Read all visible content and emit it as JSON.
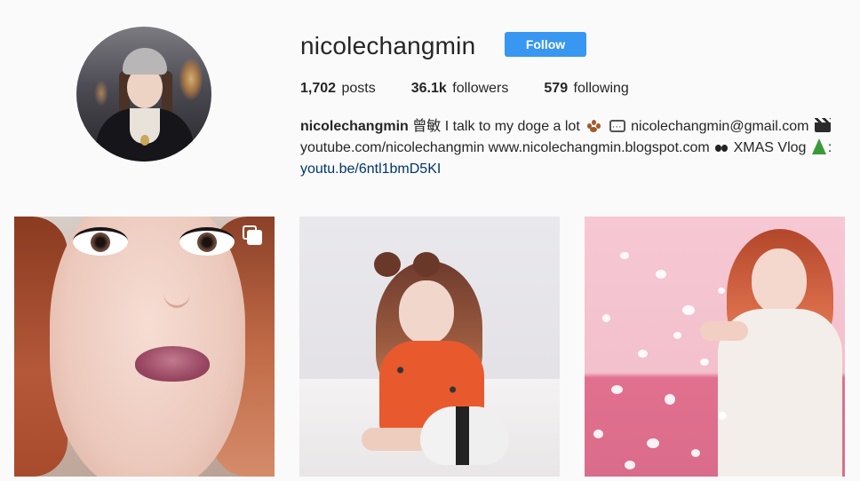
{
  "profile": {
    "username": "nicolechangmin",
    "follow_label": "Follow",
    "stats": {
      "posts_count": "1,702",
      "posts_label": "posts",
      "followers_count": "36.1k",
      "followers_label": "followers",
      "following_count": "579",
      "following_label": "following"
    },
    "bio": {
      "full_name": "nicolechangmin",
      "line1_text": "曾敏 I talk to my doge a lot",
      "email": "nicolechangmin@gmail.com",
      "line2_text": "youtube.com/nicolechangmin www.nicolechangmin.blogspot.com",
      "vlog_text": "XMAS Vlog",
      "colon": ":",
      "link": "youtu.be/6ntl1bmD5KI"
    }
  },
  "colors": {
    "follow_button": "#3897f0",
    "link": "#003569",
    "background": "#fafafa"
  },
  "icons": {
    "multi_post": "multiple-images-icon",
    "paw": "paw-prints-emoji",
    "speech": "speech-bubble-emoji",
    "clapper": "clapper-board-emoji",
    "bow": "bow-emoji",
    "tree": "christmas-tree-emoji"
  },
  "posts": [
    {
      "type": "carousel"
    },
    {
      "type": "photo"
    },
    {
      "type": "photo"
    }
  ]
}
